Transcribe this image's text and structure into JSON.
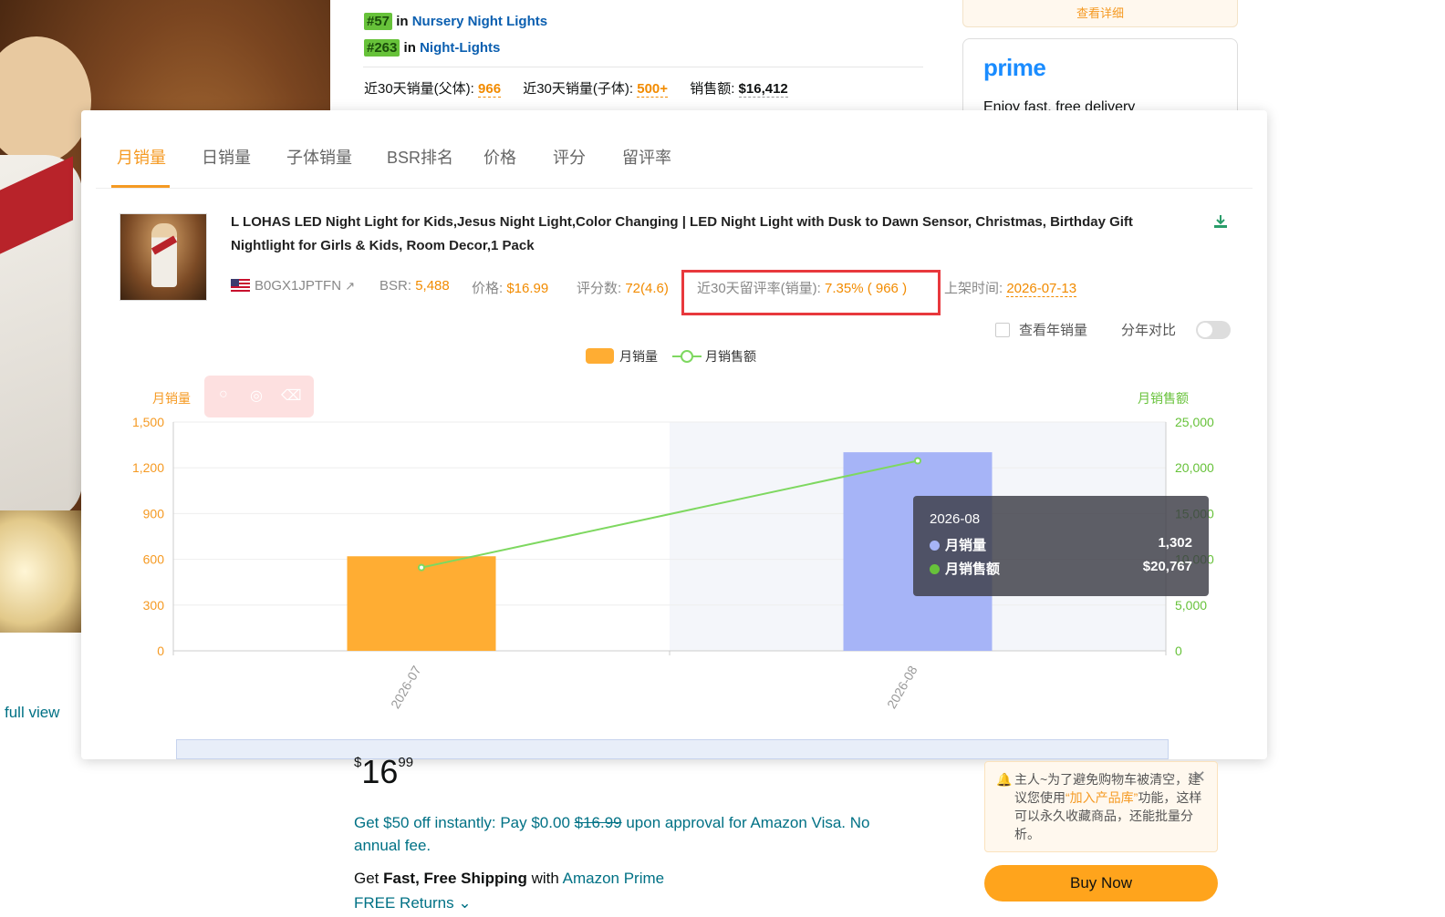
{
  "background_page": {
    "bsr_lines": [
      {
        "rank": "#57",
        "in": "in",
        "category": "Nursery Night Lights"
      },
      {
        "rank": "#263",
        "in": "in",
        "category": "Night-Lights"
      }
    ],
    "stats": {
      "parent_label": "近30天销量(父体):",
      "parent_value": "966",
      "child_label": "近30天销量(子体):",
      "child_value": "500+",
      "sales_label": "销售额:",
      "sales_value": "$16,412"
    },
    "view_details": "查看详细",
    "prime_logo": "prime",
    "prime_text": "Enjoy fast, free delivery",
    "full_view": "full view",
    "price": {
      "currency": "$",
      "whole": "16",
      "fraction": "99"
    },
    "offer_text_1": "Get $50 off instantly: Pay $0.00 ",
    "offer_strike": "$16.99",
    "offer_text_2": " upon approval for Amazon Visa. No annual fee.",
    "ship_prefix": "Get ",
    "ship_bold": "Fast, Free Shipping",
    "ship_with": " with ",
    "ship_link": "Amazon Prime",
    "returns": "FREE Returns",
    "notice": {
      "pre": "主人~为了避免购物车被清空，建议您使用",
      "link": "“加入产品库”",
      "post": "功能，这样可以永久收藏商品，还能批量分析。"
    },
    "buy_now": "Buy Now"
  },
  "panel": {
    "tabs": [
      "月销量",
      "日销量",
      "子体销量",
      "BSR排名",
      "价格",
      "评分",
      "留评率"
    ],
    "active_tab": 0,
    "product_title": "L LOHAS LED Night Light for Kids,Jesus Night Light,Color Changing | LED Night Light with Dusk to Dawn Sensor, Christmas, Birthday Gift Nightlight for Girls & Kids, Room Decor,1 Pack",
    "asin": "B0GX1JPTFN",
    "bsr_label": "BSR:",
    "bsr_value": "5,488",
    "price_label": "价格:",
    "price_value": "$16.99",
    "rating_label": "评分数:",
    "rating_value": "72(4.6)",
    "review_rate_label": "近30天留评率(销量):",
    "review_rate_value": "7.35% ( 966 )",
    "listed_label": "上架时间:",
    "listed_value": "2026-07-13",
    "view_yearly": "查看年销量",
    "yoy_compare": "分年对比",
    "legend_units": "月销量",
    "legend_revenue": "月销售额",
    "axis_left_title": "月销量",
    "axis_right_title": "月销售额",
    "tooltip": {
      "title": "2026-08",
      "units_label": "月销量",
      "units_value": "1,302",
      "revenue_label": "月销售额",
      "revenue_value": "$20,767"
    },
    "colors": {
      "accent": "#f59a23",
      "bar1": "#ffad33",
      "bar2": "#a6b4f7",
      "line": "#7ed860",
      "highlight": "#e8383d"
    }
  },
  "chart_data": {
    "type": "bar",
    "categories": [
      "2026-07",
      "2026-08"
    ],
    "series": [
      {
        "name": "月销量",
        "type": "bar",
        "axis": "left",
        "values": [
          620,
          1302
        ]
      },
      {
        "name": "月销售额",
        "type": "line",
        "axis": "right",
        "values": [
          9100,
          20767
        ]
      }
    ],
    "ylim_left": [
      0,
      1500
    ],
    "yticks_left": [
      "0",
      "300",
      "600",
      "900",
      "1,200",
      "1,500"
    ],
    "ylim_right": [
      0,
      25000
    ],
    "yticks_right": [
      "0",
      "5,000",
      "10,000",
      "15,000",
      "20,000",
      "25,000"
    ],
    "grid": true,
    "legend_position": "top-center"
  }
}
